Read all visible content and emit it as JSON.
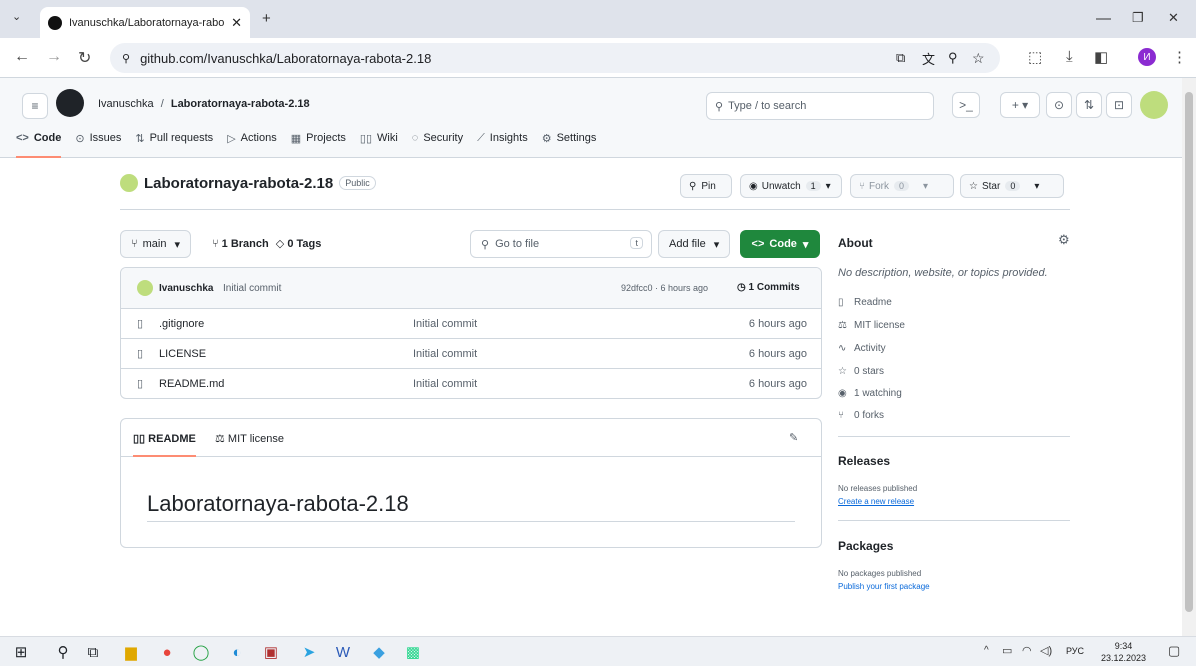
{
  "browser": {
    "tab_title": "Ivanuschka/Laboratornaya-rabo",
    "url": "github.com/Ivanuschka/Laboratornaya-rabota-2.18",
    "profile_initial": "И"
  },
  "header": {
    "owner": "Ivanuschka",
    "separator": "/",
    "repo": "Laboratornaya-rabota-2.18",
    "search_placeholder": "Type / to search"
  },
  "repo_nav": [
    {
      "label": "Code",
      "icon": "code-icon",
      "glyph": "<>"
    },
    {
      "label": "Issues",
      "icon": "issue-icon",
      "glyph": "⊙"
    },
    {
      "label": "Pull requests",
      "icon": "pull-request-icon",
      "glyph": "⇅"
    },
    {
      "label": "Actions",
      "icon": "play-icon",
      "glyph": "▷"
    },
    {
      "label": "Projects",
      "icon": "table-icon",
      "glyph": "▦"
    },
    {
      "label": "Wiki",
      "icon": "book-icon",
      "glyph": "▯▯"
    },
    {
      "label": "Security",
      "icon": "shield-icon",
      "glyph": "◌"
    },
    {
      "label": "Insights",
      "icon": "graph-icon",
      "glyph": "⟋"
    },
    {
      "label": "Settings",
      "icon": "gear-icon",
      "glyph": "⚙"
    }
  ],
  "repo": {
    "title": "Laboratornaya-rabota-2.18",
    "visibility": "Public",
    "pin": "Pin",
    "unwatch": "Unwatch",
    "watch_count": "1",
    "fork": "Fork",
    "fork_count": "0",
    "star": "Star",
    "star_count": "0"
  },
  "toolbar": {
    "branch": "main",
    "branches": "1 Branch",
    "tags": "0 Tags",
    "goto_placeholder": "Go to file",
    "goto_key": "t",
    "add_file": "Add file",
    "code": "Code"
  },
  "commit": {
    "author": "Ivanuschka",
    "message": "Initial commit",
    "hash_time": "92dfcc0 · 6 hours ago",
    "commits": "1 Commits"
  },
  "files": [
    {
      "name": ".gitignore",
      "message": "Initial commit",
      "time": "6 hours ago"
    },
    {
      "name": "LICENSE",
      "message": "Initial commit",
      "time": "6 hours ago"
    },
    {
      "name": "README.md",
      "message": "Initial commit",
      "time": "6 hours ago"
    }
  ],
  "readme": {
    "tab_readme": "README",
    "tab_license": "MIT license",
    "heading": "Laboratornaya-rabota-2.18"
  },
  "about": {
    "title": "About",
    "description": "No description, website, or topics provided.",
    "items": [
      "Readme",
      "MIT license",
      "Activity",
      "0 stars",
      "1 watching",
      "0 forks"
    ],
    "stars_bold": "0",
    "watching_bold": "1",
    "forks_bold": "0"
  },
  "releases": {
    "title": "Releases",
    "none": "No releases published",
    "link": "Create a new release"
  },
  "packages": {
    "title": "Packages",
    "none": "No packages published",
    "link": "Publish your first package"
  },
  "taskbar": {
    "lang": "РУС",
    "time": "9:34",
    "date": "23.12.2023"
  },
  "colors": {
    "accent_green": "#1f883d",
    "link_blue": "#0969da",
    "selected_underline": "#fd8c73"
  }
}
